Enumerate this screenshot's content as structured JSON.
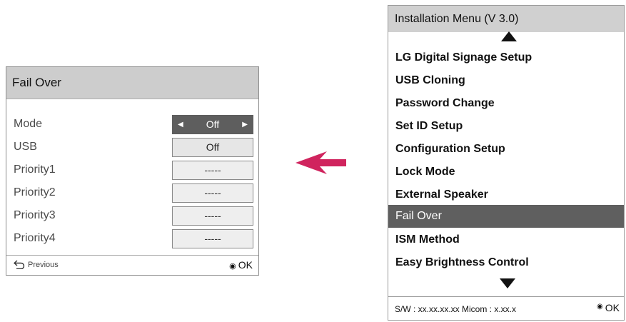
{
  "fail_over_panel": {
    "title": "Fail Over",
    "rows": [
      {
        "label": "Mode",
        "value": "Off"
      },
      {
        "label": "USB",
        "value": "Off"
      },
      {
        "label": "Priority1",
        "value": "-----"
      },
      {
        "label": "Priority2",
        "value": "-----"
      },
      {
        "label": "Priority3",
        "value": "-----"
      },
      {
        "label": "Priority4",
        "value": "-----"
      }
    ],
    "previous_label": "Previous",
    "ok_label": "OK",
    "ok_icon": "ok-button-icon",
    "previous_icon": "return-arrow-icon"
  },
  "arrow": {
    "icon": "left-arrow-icon",
    "color": "#d0245e"
  },
  "installation_menu": {
    "title": "Installation Menu (V 3.0)",
    "items": [
      "LG Digital Signage Setup",
      "USB Cloning",
      "Password Change",
      "Set ID Setup",
      "Configuration Setup",
      "Lock Mode",
      "External Speaker",
      "Fail Over",
      "ISM Method",
      "Easy Brightness Control"
    ],
    "selected_item": "Fail Over",
    "version_text": "S/W : xx.xx.xx.xx Micom : x.xx.x",
    "ok_label": "OK"
  },
  "colors": {
    "header_gray": "#cdcdcd",
    "selected_gray": "#5f5f5f",
    "arrow_magenta": "#d0245e"
  }
}
